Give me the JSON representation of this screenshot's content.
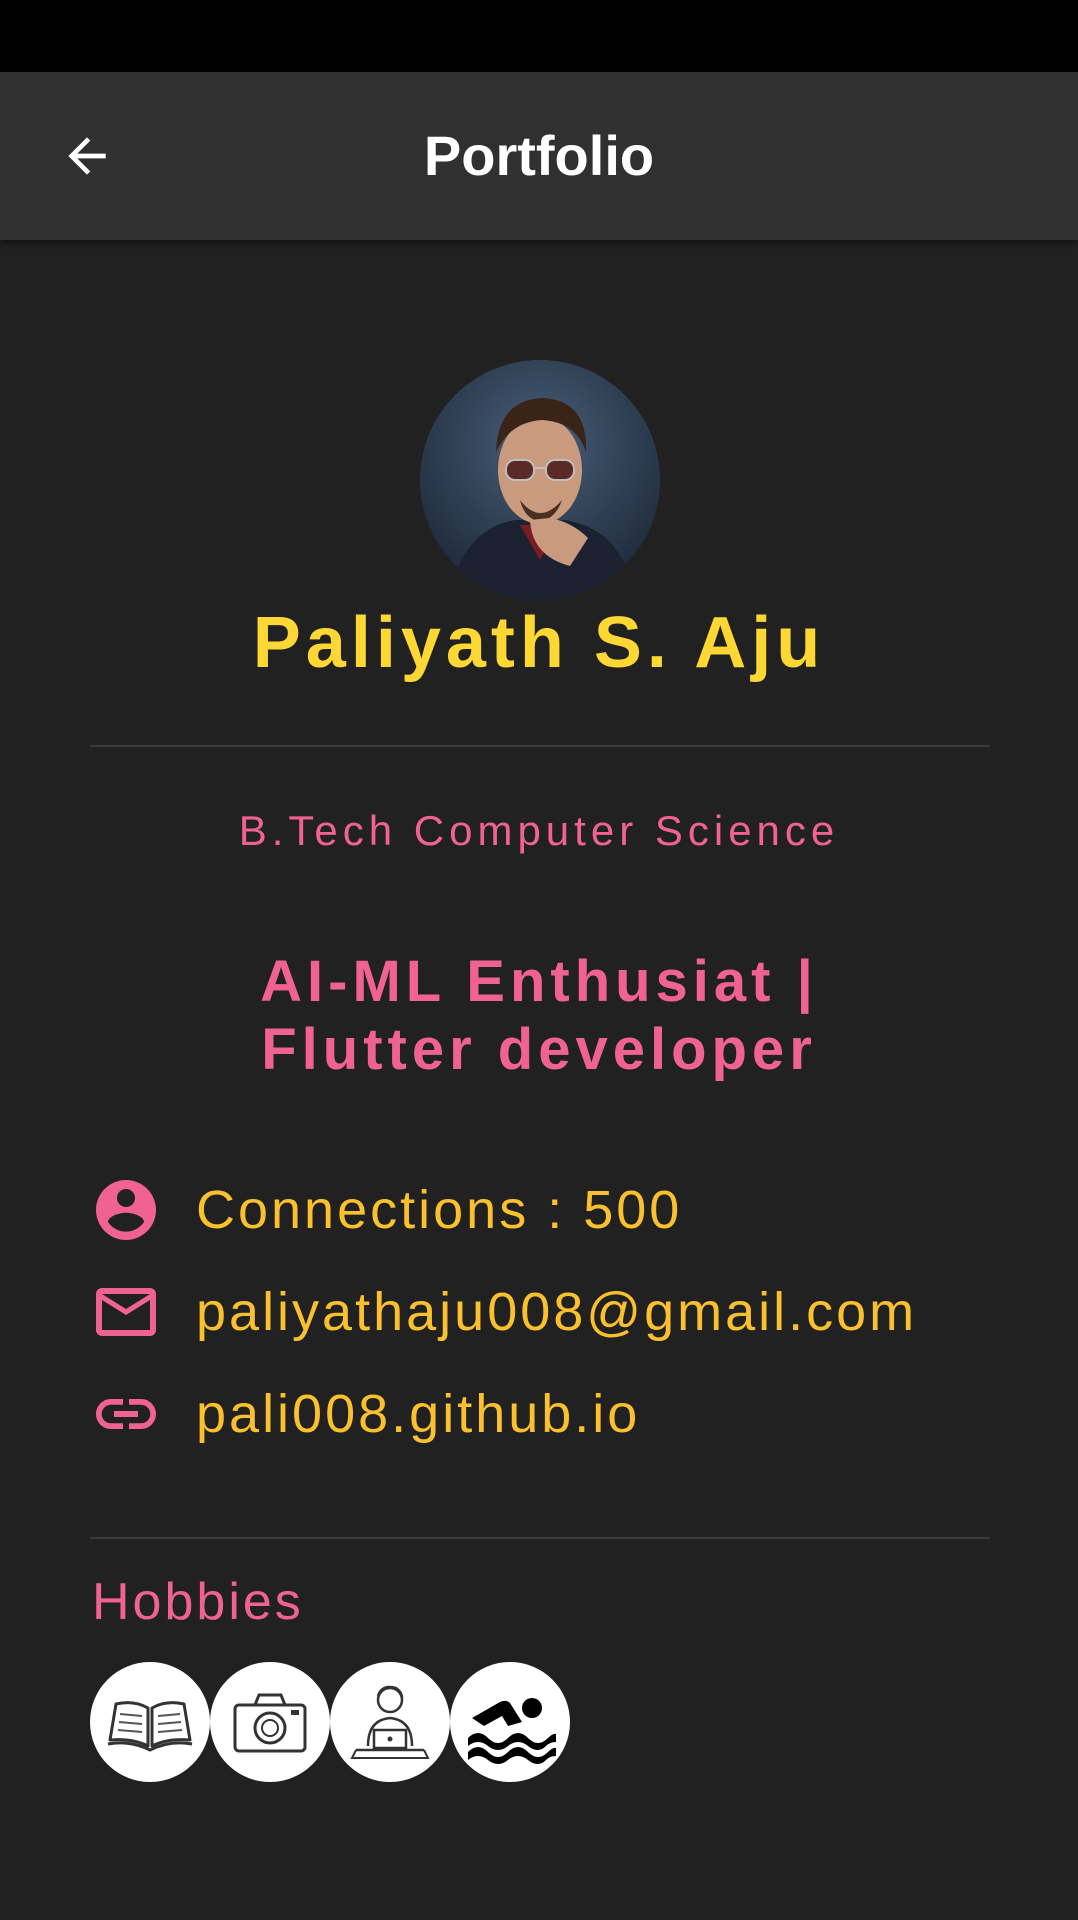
{
  "app_bar": {
    "title": "Portfolio",
    "back_icon": "arrow-back-icon"
  },
  "profile": {
    "avatar_icon": "profile-photo",
    "name": "Paliyath S. Aju",
    "degree": "B.Tech Computer Science",
    "tagline_line1": "AI-ML Enthusiat |",
    "tagline_line2": "Flutter developer"
  },
  "info": [
    {
      "icon": "account-circle-icon",
      "text": "Connections : 500"
    },
    {
      "icon": "mail-icon",
      "text": "paliyathaju008@gmail.com"
    },
    {
      "icon": "link-icon",
      "text": "pali008.github.io"
    }
  ],
  "hobbies": {
    "title": "Hobbies",
    "items": [
      {
        "icon": "book-icon"
      },
      {
        "icon": "camera-icon"
      },
      {
        "icon": "coding-person-icon"
      },
      {
        "icon": "swimming-icon"
      }
    ]
  },
  "colors": {
    "background": "#212121",
    "app_bar": "#303030",
    "name": "#fdd835",
    "accent_pink": "#f06292",
    "info_text": "#fbc02d"
  }
}
